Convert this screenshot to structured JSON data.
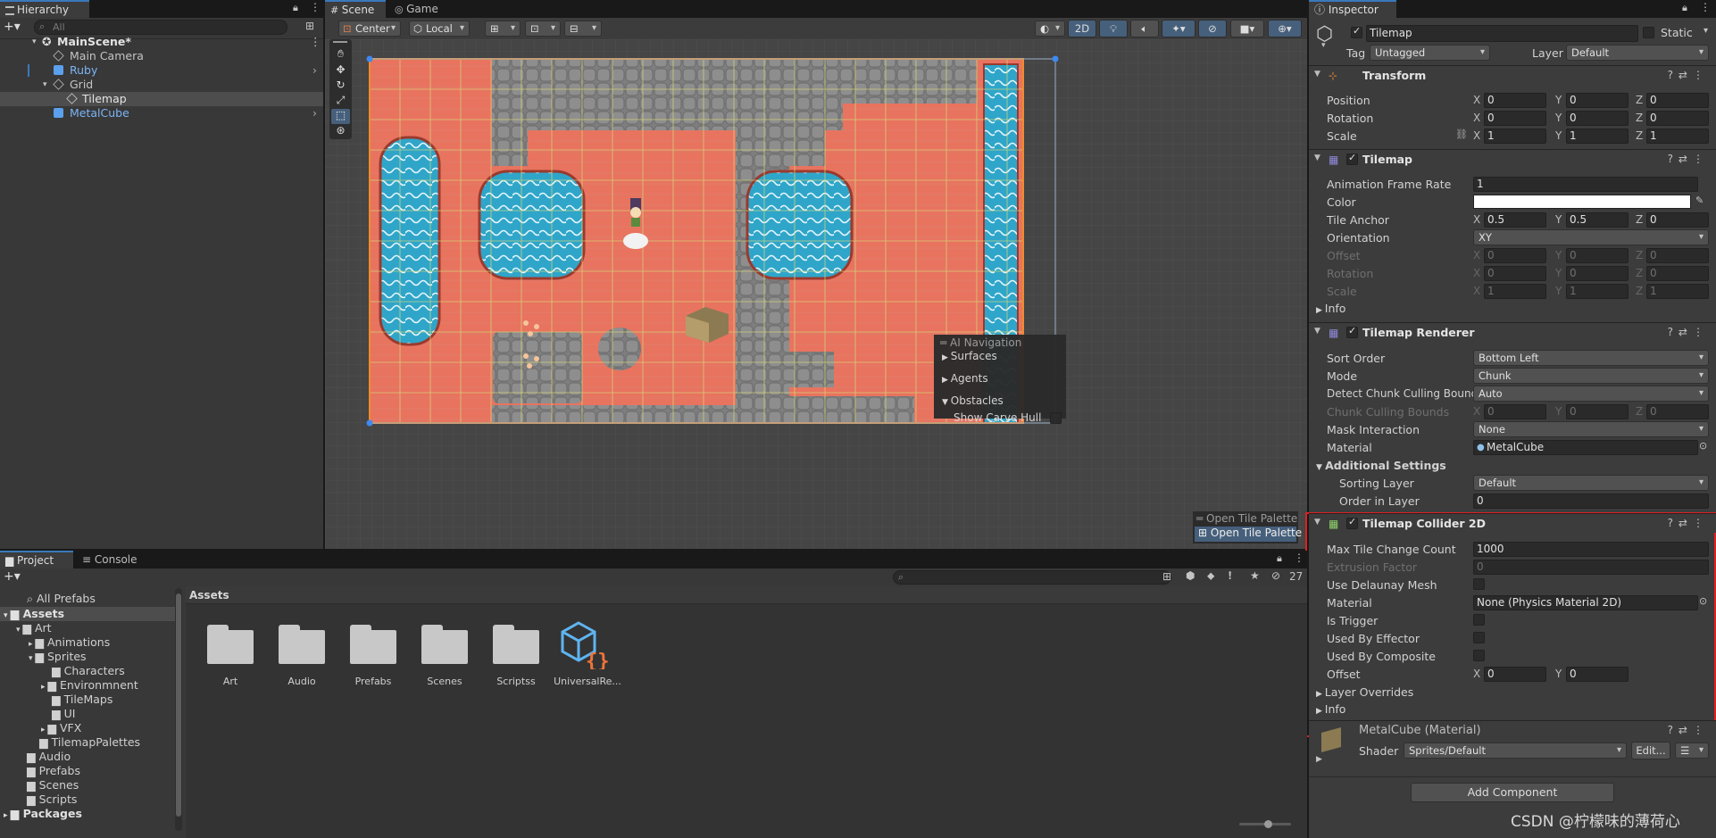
{
  "hierarchy": {
    "tab": "Hierarchy",
    "search_placeholder": "All",
    "items": [
      {
        "label": "MainScene*",
        "indent": 0,
        "bold": true,
        "color": "#e2e2e2"
      },
      {
        "label": "Main Camera",
        "indent": 2,
        "color": "#d0d0d0"
      },
      {
        "label": "Ruby",
        "indent": 2,
        "color": "#7cb4f5"
      },
      {
        "label": "Grid",
        "indent": 2,
        "color": "#d0d0d0"
      },
      {
        "label": "Tilemap",
        "indent": 3,
        "color": "#d0d0d0"
      },
      {
        "label": "MetalCube",
        "indent": 2,
        "color": "#7cb4f5"
      }
    ]
  },
  "scene": {
    "tabs": [
      "Scene",
      "Game"
    ],
    "pivot": "Center",
    "space": "Local",
    "mode_2d": "2D",
    "ai_nav": {
      "title": "AI Navigation",
      "items": [
        "Surfaces",
        "Agents",
        "Obstacles"
      ],
      "show_carve_hull": "Show Carve Hull"
    },
    "palette_header": "Open Tile Palette",
    "palette_button": "Open Tile Palette"
  },
  "inspector": {
    "tab": "Inspector",
    "object_name": "Tilemap",
    "static_label": "Static",
    "tag_label": "Tag",
    "tag_value": "Untagged",
    "layer_label": "Layer",
    "layer_value": "Default",
    "transform": {
      "title": "Transform",
      "position": {
        "label": "Position",
        "x": "0",
        "y": "0",
        "z": "0"
      },
      "rotation": {
        "label": "Rotation",
        "x": "0",
        "y": "0",
        "z": "0"
      },
      "scale": {
        "label": "Scale",
        "x": "1",
        "y": "1",
        "z": "1"
      }
    },
    "tilemap": {
      "title": "Tilemap",
      "anim_rate_label": "Animation Frame Rate",
      "anim_rate": "1",
      "color_label": "Color",
      "tile_anchor_label": "Tile Anchor",
      "tile_anchor": {
        "x": "0.5",
        "y": "0.5",
        "z": "0"
      },
      "orientation_label": "Orientation",
      "orientation": "XY",
      "offset": {
        "label": "Offset",
        "x": "0",
        "y": "0",
        "z": "0"
      },
      "rotation": {
        "label": "Rotation",
        "x": "0",
        "y": "0",
        "z": "0"
      },
      "scale": {
        "label": "Scale",
        "x": "1",
        "y": "1",
        "z": "1"
      },
      "info": "Info"
    },
    "renderer": {
      "title": "Tilemap Renderer",
      "sort_order_label": "Sort Order",
      "sort_order": "Bottom Left",
      "mode_label": "Mode",
      "mode": "Chunk",
      "detect_label": "Detect Chunk Culling Bounds",
      "detect": "Auto",
      "chunk_bounds": {
        "label": "Chunk Culling Bounds",
        "x": "0",
        "y": "0",
        "z": "0"
      },
      "mask_label": "Mask Interaction",
      "mask": "None",
      "material_label": "Material",
      "material": "MetalCube",
      "additional": "Additional Settings",
      "sorting_layer_label": "Sorting Layer",
      "sorting_layer": "Default",
      "order_label": "Order in Layer",
      "order": "0"
    },
    "collider": {
      "title": "Tilemap Collider 2D",
      "max_label": "Max Tile Change Count",
      "max": "1000",
      "extrusion_label": "Extrusion Factor",
      "extrusion": "0",
      "delaunay_label": "Use Delaunay Mesh",
      "material_label": "Material",
      "material": "None (Physics Material 2D)",
      "trigger_label": "Is Trigger",
      "effector_label": "Used By Effector",
      "composite_label": "Used By Composite",
      "offset_label": "Offset",
      "offset": {
        "x": "0",
        "y": "0"
      },
      "layer_overrides": "Layer Overrides",
      "info": "Info"
    },
    "material": {
      "title": "MetalCube (Material)",
      "shader_label": "Shader",
      "shader": "Sprites/Default",
      "edit": "Edit..."
    },
    "add_component": "Add Component"
  },
  "project": {
    "tabs": [
      "Project",
      "Console"
    ],
    "count": "27",
    "tree": [
      {
        "label": "All Prefabs",
        "indent": 1,
        "icon": "search"
      },
      {
        "label": "Assets",
        "indent": 0,
        "bold": true,
        "fold": "▾"
      },
      {
        "label": "Art",
        "indent": 1,
        "fold": "▾"
      },
      {
        "label": "Animations",
        "indent": 2,
        "fold": "▸"
      },
      {
        "label": "Sprites",
        "indent": 2,
        "fold": "▾"
      },
      {
        "label": "Characters",
        "indent": 3
      },
      {
        "label": "Environmnent",
        "indent": 3,
        "fold": "▸"
      },
      {
        "label": "TileMaps",
        "indent": 3
      },
      {
        "label": "UI",
        "indent": 3
      },
      {
        "label": "VFX",
        "indent": 3,
        "fold": "▸"
      },
      {
        "label": "TilemapPalettes",
        "indent": 2
      },
      {
        "label": "Audio",
        "indent": 1
      },
      {
        "label": "Prefabs",
        "indent": 1
      },
      {
        "label": "Scenes",
        "indent": 1
      },
      {
        "label": "Scripts",
        "indent": 1
      },
      {
        "label": "Packages",
        "indent": 0,
        "bold": true,
        "fold": "▸"
      }
    ],
    "breadcrumb": "Assets",
    "assets": [
      "Art",
      "Audio",
      "Prefabs",
      "Scenes",
      "Scriptss",
      "UniversalRe..."
    ]
  },
  "watermark": "CSDN @柠檬味的薄荷心",
  "colors": {
    "accent": "#3a79bb",
    "highlight": "#e02020",
    "sand": "#e8735f",
    "water": "#2fa6c9",
    "stone": "#8a8a8a"
  }
}
